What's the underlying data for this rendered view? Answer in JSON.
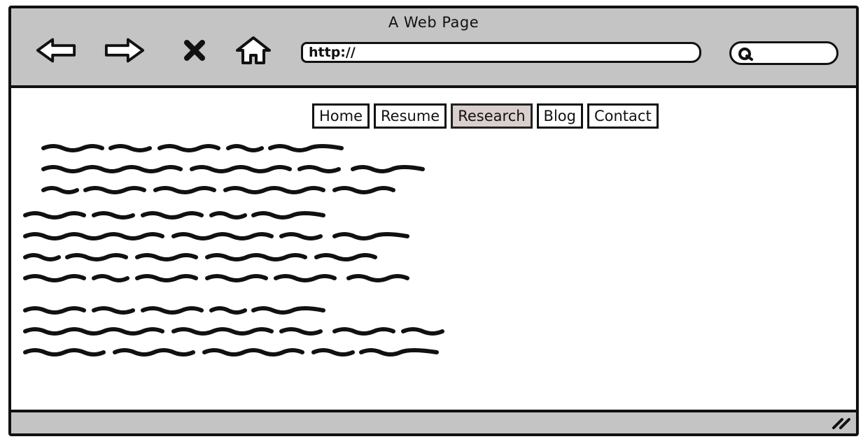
{
  "window": {
    "title": "A Web Page"
  },
  "toolbar": {
    "back_icon": "back-arrow-icon",
    "forward_icon": "forward-arrow-icon",
    "stop_icon": "close-icon",
    "home_icon": "home-icon",
    "url_value": "http://",
    "search_icon": "search-icon"
  },
  "nav": {
    "tabs": [
      {
        "label": "Home"
      },
      {
        "label": "Resume"
      },
      {
        "label": "Research"
      },
      {
        "label": "Blog"
      },
      {
        "label": "Contact"
      }
    ],
    "active_tab": "Research"
  },
  "colors": {
    "chrome": "#c4c4c4",
    "ink": "#111111",
    "active_tab_bg": "#d9cfcc"
  }
}
